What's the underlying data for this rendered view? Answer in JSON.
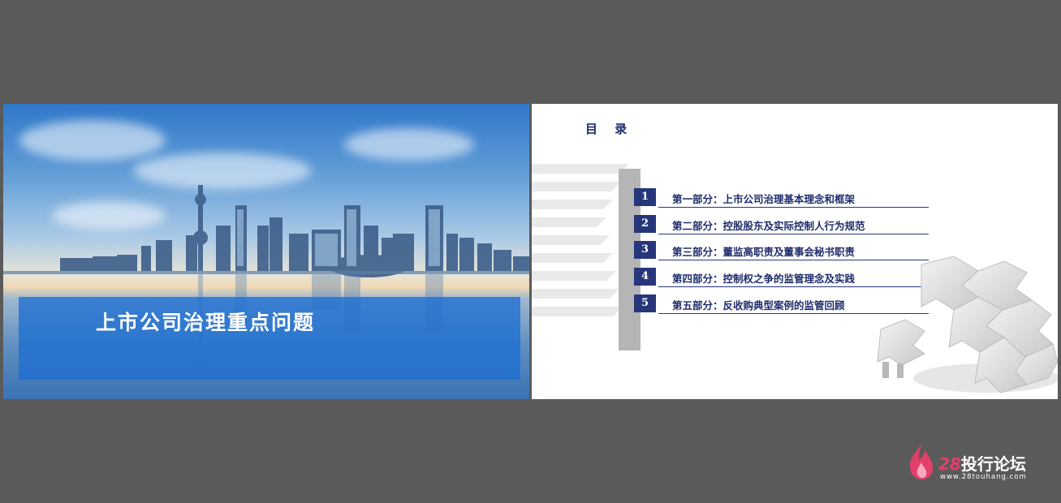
{
  "cover": {
    "title": "上市公司治理重点问题"
  },
  "toc": {
    "heading": "目 录",
    "items": [
      {
        "number": "1",
        "label": "第一部分：上市公司治理基本理念和框架"
      },
      {
        "number": "2",
        "label": "第二部分：控股股东及实际控制人行为规范"
      },
      {
        "number": "3",
        "label": "第三部分：董监高职责及董事会秘书职责"
      },
      {
        "number": "4",
        "label": "第四部分：控制权之争的监管理念及实践"
      },
      {
        "number": "5",
        "label": "第五部分：反收购典型案例的监管回顾"
      }
    ]
  },
  "watermark": {
    "brand_number": "28",
    "brand_text": "投行论坛",
    "url": "www.28touhang.com"
  },
  "colors": {
    "background": "#5a5a5a",
    "navy": "#27367a",
    "title_band": "#1e6ed2",
    "brand_pink": "#e23f6a"
  }
}
